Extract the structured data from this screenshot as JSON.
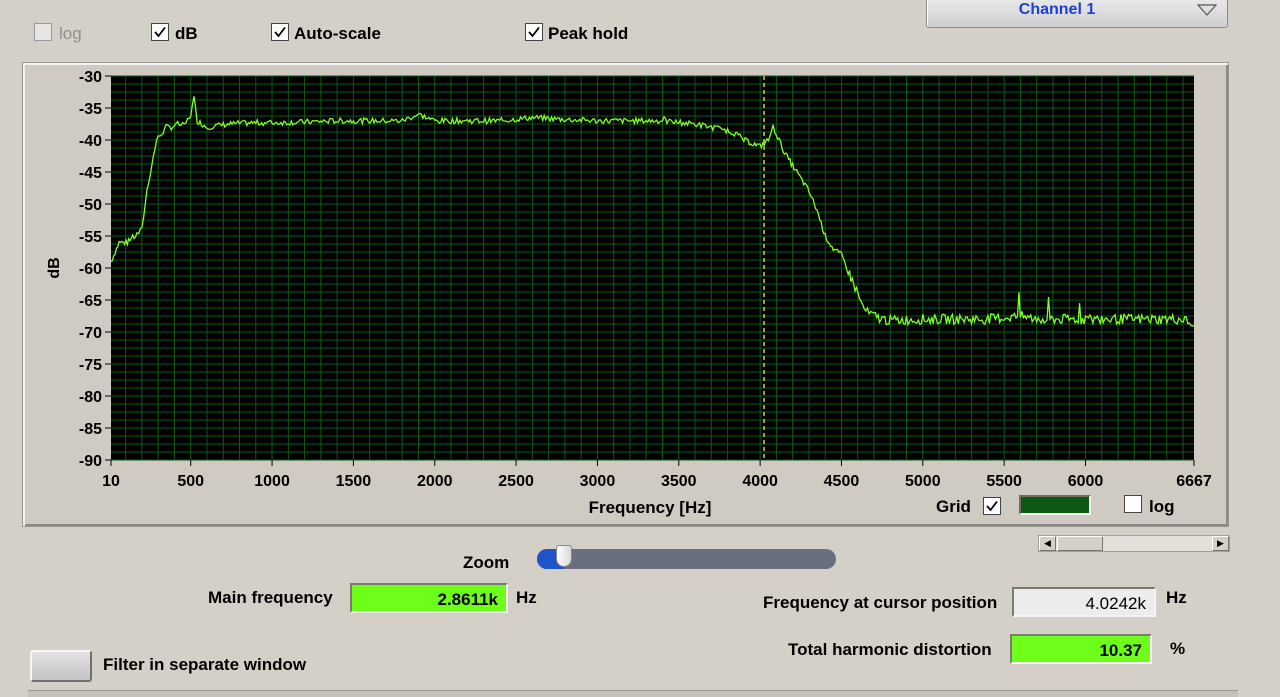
{
  "options": {
    "log_label": "log",
    "db_label": "dB",
    "autoscale_label": "Auto-scale",
    "peakhold_label": "Peak hold"
  },
  "channel": {
    "selected": "Channel 1"
  },
  "graph": {
    "grid_label": "Grid",
    "grid_checked": true,
    "grid_color": "#0f5a12",
    "log_label": "log",
    "log_checked": false
  },
  "chart_data": {
    "type": "line",
    "xlabel": "Frequency [Hz]",
    "ylabel": "dB",
    "xlim": [
      10,
      6667
    ],
    "ylim": [
      -90,
      -30
    ],
    "x_ticks": [
      "10",
      "500",
      "1000",
      "1500",
      "2000",
      "2500",
      "3000",
      "3500",
      "4000",
      "4500",
      "5000",
      "5500",
      "6000",
      "6667"
    ],
    "y_ticks": [
      "-30",
      "-35",
      "-40",
      "-45",
      "-50",
      "-55",
      "-60",
      "-65",
      "-70",
      "-75",
      "-80",
      "-85",
      "-90"
    ],
    "grid": true,
    "background": "#000000",
    "line_color": "#7fff2a",
    "cursor_color": "#e8e86a",
    "cursor_x": 4024.2,
    "series": [
      {
        "x": [
          10,
          60,
          110,
          160,
          200,
          230,
          260,
          290,
          320,
          350,
          380,
          420,
          460,
          500,
          520,
          540,
          600,
          700,
          800,
          900,
          1000,
          1200,
          1400,
          1600,
          1800,
          1900,
          2000,
          2200,
          2400,
          2600,
          2800,
          3000,
          3200,
          3400,
          3600,
          3700,
          3800,
          3850,
          3900,
          3950,
          4000,
          4050,
          4080,
          4100,
          4150,
          4200,
          4250,
          4300,
          4350,
          4400,
          4450,
          4500,
          4550,
          4600,
          4630,
          4660,
          4700,
          4750,
          4800,
          5000,
          5200,
          5400,
          5600,
          5700,
          5800,
          6000,
          6200,
          6400,
          6500,
          6600,
          6667
        ],
        "y": [
          -59,
          -56,
          -56,
          -55,
          -54,
          -48,
          -44,
          -40,
          -39,
          -38,
          -38,
          -37.5,
          -37.8,
          -36,
          -33.5,
          -37,
          -38,
          -37.6,
          -37.4,
          -37.3,
          -37.3,
          -37.2,
          -37,
          -37,
          -37,
          -36,
          -37,
          -37,
          -37,
          -36.5,
          -36.8,
          -37,
          -37,
          -37,
          -37.5,
          -38,
          -38.5,
          -39,
          -40,
          -40.5,
          -41,
          -40,
          -38,
          -39,
          -42,
          -44,
          -46,
          -48,
          -51,
          -55,
          -57,
          -58,
          -61,
          -64,
          -66,
          -67,
          -67.5,
          -68,
          -68.2,
          -68,
          -68,
          -68,
          -67.5,
          -68,
          -68,
          -68,
          -68,
          -68,
          -68,
          -68,
          -69
        ]
      }
    ]
  },
  "main_frequency": {
    "label": "Main frequency",
    "value": "2.8611k",
    "unit": "Hz"
  },
  "zoom": {
    "label": "Zoom",
    "level": 0.03
  },
  "cursor_frequency": {
    "label": "Frequency at cursor position",
    "value": "4.0242k",
    "unit": "Hz"
  },
  "thd": {
    "label": "Total harmonic distortion",
    "value": "10.37",
    "unit": "%"
  },
  "filter": {
    "label": "Filter in separate window"
  }
}
